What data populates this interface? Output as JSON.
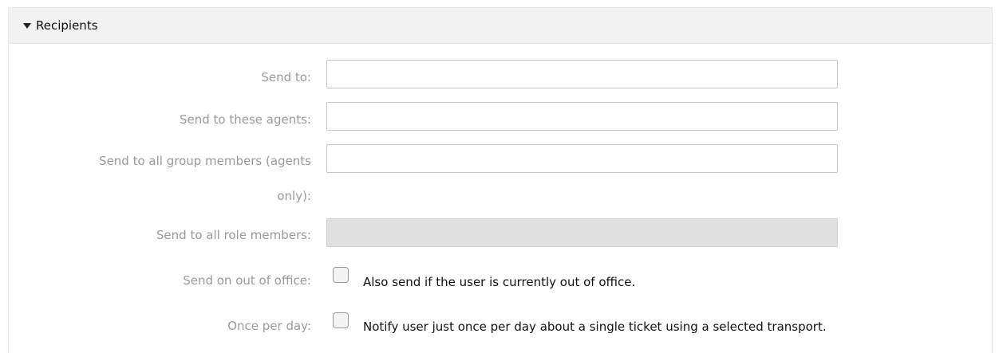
{
  "section": {
    "title": "Recipients",
    "toggle_icon": "triangle-down-icon"
  },
  "fields": {
    "send_to": {
      "label": "Send to:",
      "value": ""
    },
    "send_to_agents": {
      "label": "Send to these agents:",
      "value": ""
    },
    "send_to_group_members": {
      "label_line1": "Send to all group members (agents",
      "label_line2": "only):",
      "value": ""
    },
    "send_to_role_members": {
      "label": "Send to all role members:",
      "value": "",
      "disabled": true
    },
    "out_of_office": {
      "label": "Send on out of office:",
      "checkbox_text": "Also send if the user is currently out of office.",
      "checked": false
    },
    "once_per_day": {
      "label": "Once per day:",
      "checkbox_text": "Notify user just once per day about a single ticket using a selected transport.",
      "checked": false
    }
  },
  "colors": {
    "header_bg": "#f2f2f2",
    "label_text": "#9a9a9a",
    "disabled_field": "#e0e0e0"
  }
}
